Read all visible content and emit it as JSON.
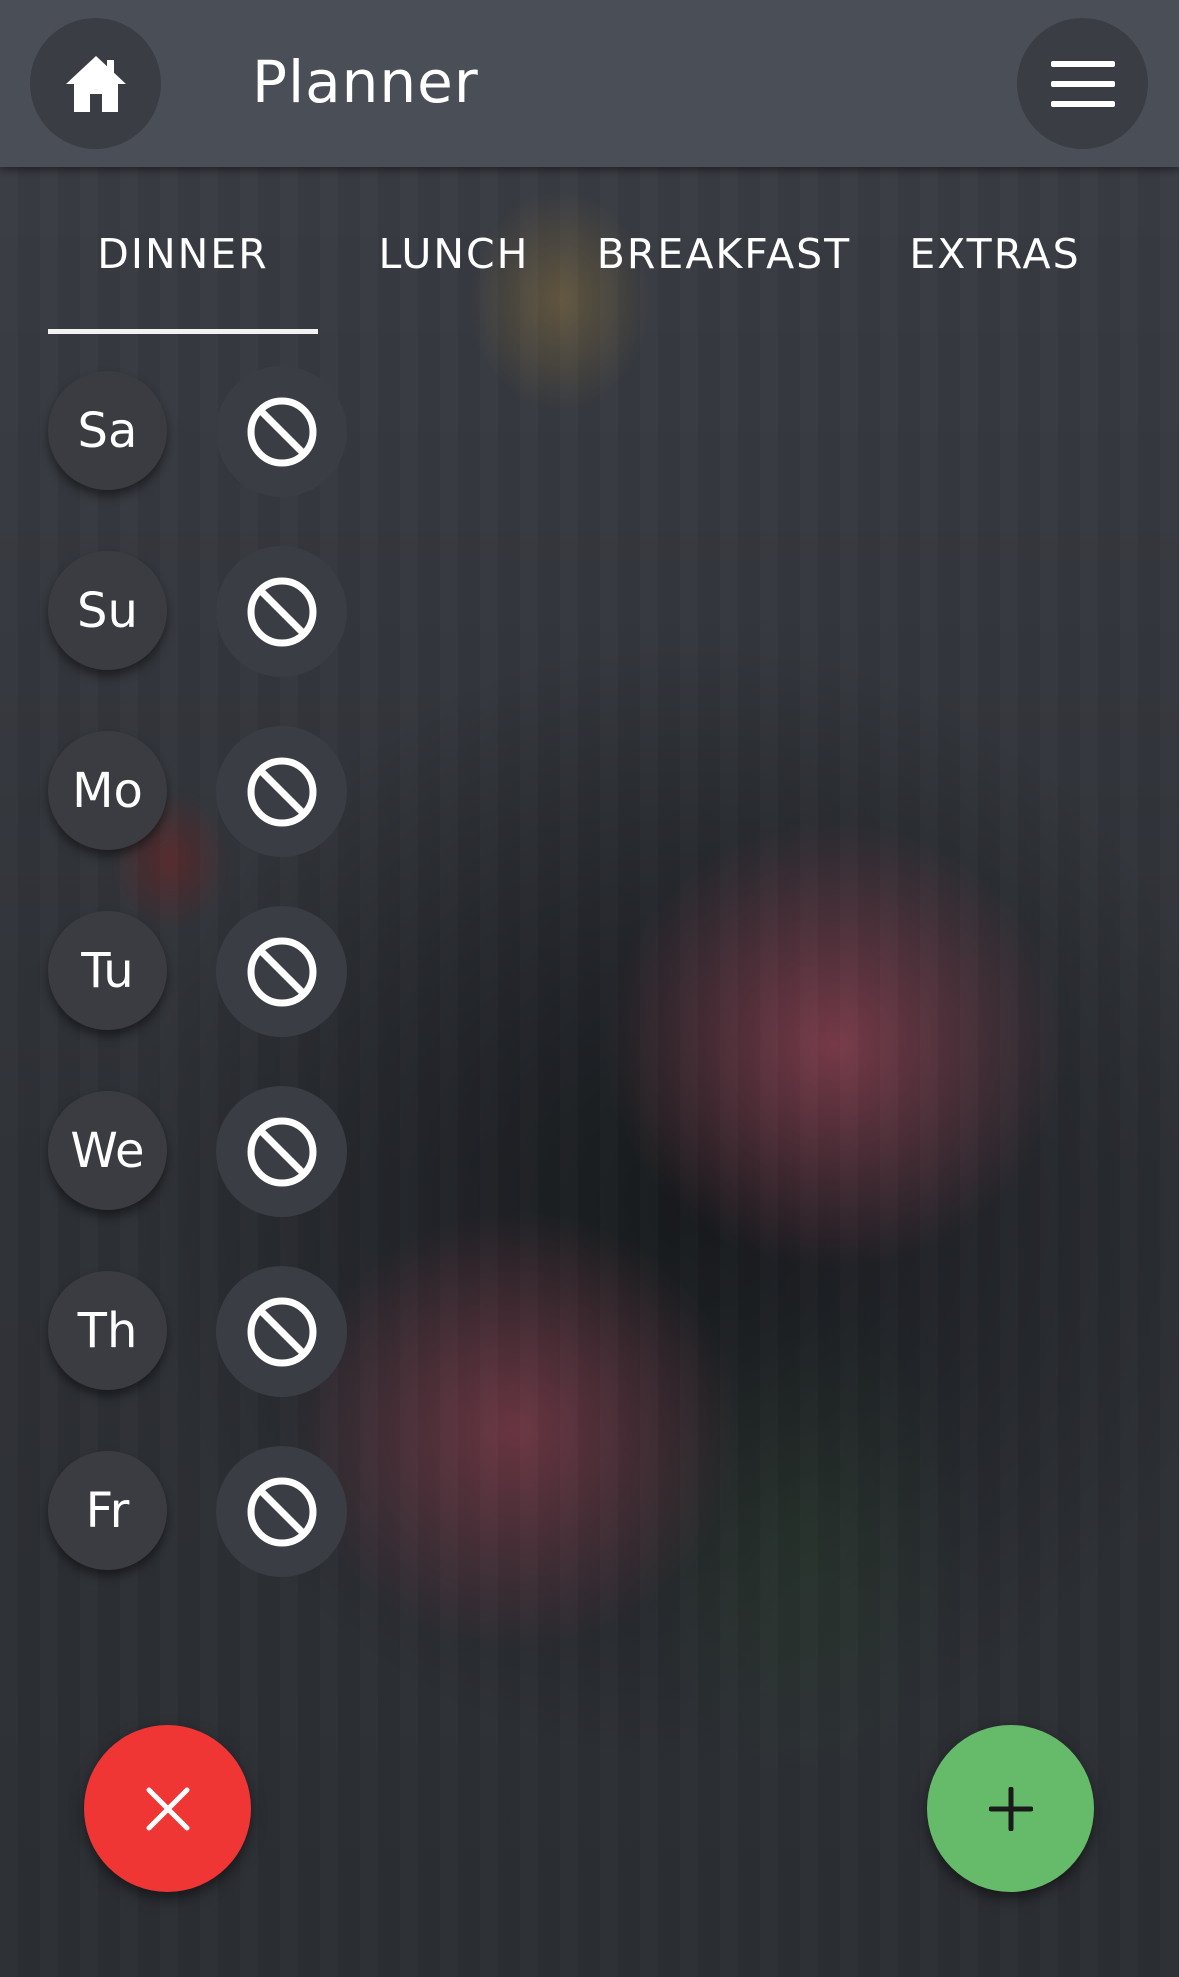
{
  "header": {
    "title": "Planner",
    "home_icon": "home-icon",
    "menu_icon": "hamburger-menu-icon"
  },
  "tabs": [
    {
      "label": "DINNER",
      "selected": true
    },
    {
      "label": "LUNCH",
      "selected": false
    },
    {
      "label": "BREAKFAST",
      "selected": false
    },
    {
      "label": "EXTRAS",
      "selected": false
    }
  ],
  "days": [
    {
      "label": "Sa",
      "meal_icon": "no-meal-icon"
    },
    {
      "label": "Su",
      "meal_icon": "no-meal-icon"
    },
    {
      "label": "Mo",
      "meal_icon": "no-meal-icon"
    },
    {
      "label": "Tu",
      "meal_icon": "no-meal-icon"
    },
    {
      "label": "We",
      "meal_icon": "no-meal-icon"
    },
    {
      "label": "Th",
      "meal_icon": "no-meal-icon"
    },
    {
      "label": "Fr",
      "meal_icon": "no-meal-icon"
    }
  ],
  "fabs": {
    "close_icon": "close-icon",
    "add_icon": "plus-icon"
  },
  "colors": {
    "header_bg": "#4a4e57",
    "close_button": "#f03535",
    "add_button": "#66bb6a"
  }
}
